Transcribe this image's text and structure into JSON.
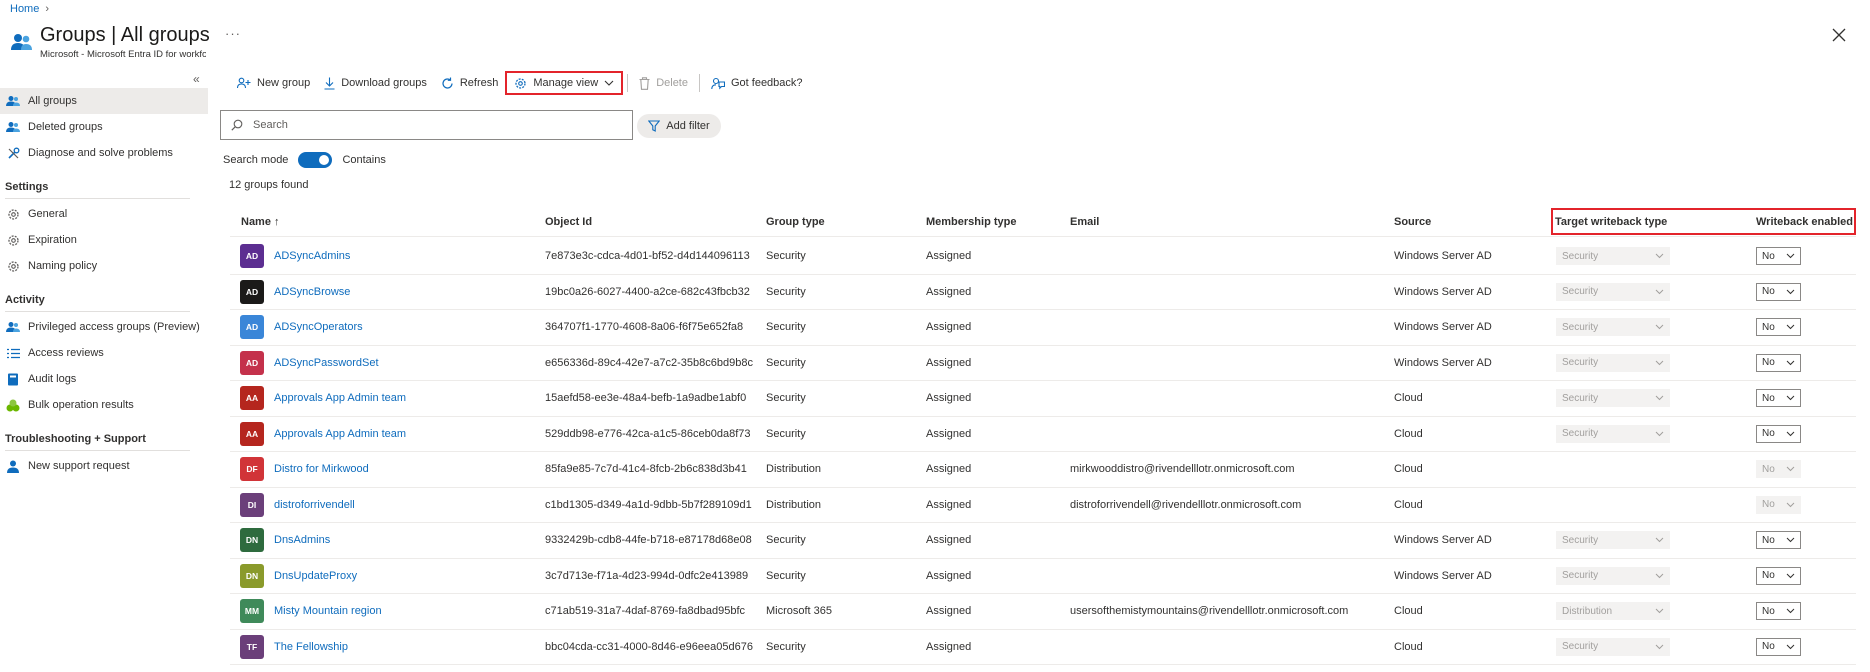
{
  "breadcrumb": {
    "home": "Home",
    "separator": "›"
  },
  "header": {
    "title": "Groups | All groups",
    "subtitle": "Microsoft - Microsoft Entra ID for workforce",
    "more": "···"
  },
  "sidebar": {
    "collapse": "«",
    "items": [
      {
        "label": "All groups",
        "icon": "groups-icon"
      },
      {
        "label": "Deleted groups",
        "icon": "groups-icon"
      },
      {
        "label": "Diagnose and solve problems",
        "icon": "wrench-icon"
      }
    ],
    "settings_title": "Settings",
    "settings": [
      {
        "label": "General",
        "icon": "gear-icon"
      },
      {
        "label": "Expiration",
        "icon": "gear-icon"
      },
      {
        "label": "Naming policy",
        "icon": "gear-icon"
      }
    ],
    "activity_title": "Activity",
    "activity": [
      {
        "label": "Privileged access groups (Preview)",
        "icon": "groups-icon"
      },
      {
        "label": "Access reviews",
        "icon": "list-icon"
      },
      {
        "label": "Audit logs",
        "icon": "book-icon"
      },
      {
        "label": "Bulk operation results",
        "icon": "bulk-icon"
      }
    ],
    "support_title": "Troubleshooting + Support",
    "support": [
      {
        "label": "New support request",
        "icon": "person-icon"
      }
    ]
  },
  "toolbar": {
    "new_group": "New group",
    "download": "Download groups",
    "refresh": "Refresh",
    "manage_view": "Manage view",
    "delete": "Delete",
    "feedback": "Got feedback?"
  },
  "search": {
    "placeholder": "Search",
    "add_filter": "Add filter",
    "mode_label": "Search mode",
    "mode_value": "Contains"
  },
  "found_text": "12 groups found",
  "columns": {
    "name": "Name ↑",
    "object_id": "Object Id",
    "group_type": "Group type",
    "membership_type": "Membership type",
    "email": "Email",
    "source": "Source",
    "target_writeback": "Target writeback type",
    "writeback_enabled": "Writeback enabled"
  },
  "colors": {
    "accent": "#0f6cbd",
    "highlight": "#e3242b"
  },
  "rows": [
    {
      "initials": "AD",
      "color": "#5c2e91",
      "name": "ADSyncAdmins",
      "object_id": "7e873e3c-cdca-4d01-bf52-d4d144096113",
      "group_type": "Security",
      "membership": "Assigned",
      "email": "",
      "source": "Windows Server AD",
      "target": "Security",
      "writeback": "No",
      "writeback_active": true
    },
    {
      "initials": "AD",
      "color": "#1b1a19",
      "name": "ADSyncBrowse",
      "object_id": "19bc0a26-6027-4400-a2ce-682c43fbcb32",
      "group_type": "Security",
      "membership": "Assigned",
      "email": "",
      "source": "Windows Server AD",
      "target": "Security",
      "writeback": "No",
      "writeback_active": true
    },
    {
      "initials": "AD",
      "color": "#3a86d8",
      "name": "ADSyncOperators",
      "object_id": "364707f1-1770-4608-8a06-f6f75e652fa8",
      "group_type": "Security",
      "membership": "Assigned",
      "email": "",
      "source": "Windows Server AD",
      "target": "Security",
      "writeback": "No",
      "writeback_active": true
    },
    {
      "initials": "AD",
      "color": "#c4314b",
      "name": "ADSyncPasswordSet",
      "object_id": "e656336d-89c4-42e7-a7c2-35b8c6bd9b8c",
      "group_type": "Security",
      "membership": "Assigned",
      "email": "",
      "source": "Windows Server AD",
      "target": "Security",
      "writeback": "No",
      "writeback_active": true
    },
    {
      "initials": "AA",
      "color": "#b5261e",
      "name": "Approvals App Admin team",
      "object_id": "15aefd58-ee3e-48a4-befb-1a9adbe1abf0",
      "group_type": "Security",
      "membership": "Assigned",
      "email": "",
      "source": "Cloud",
      "target": "Security",
      "writeback": "No",
      "writeback_active": true
    },
    {
      "initials": "AA",
      "color": "#b5261e",
      "name": "Approvals App Admin team",
      "object_id": "529ddb98-e776-42ca-a1c5-86ceb0da8f73",
      "group_type": "Security",
      "membership": "Assigned",
      "email": "",
      "source": "Cloud",
      "target": "Security",
      "writeback": "No",
      "writeback_active": true
    },
    {
      "initials": "DF",
      "color": "#d13438",
      "name": "Distro for Mirkwood",
      "object_id": "85fa9e85-7c7d-41c4-8fcb-2b6c838d3b41",
      "group_type": "Distribution",
      "membership": "Assigned",
      "email": "mirkwooddistro@rivendelllotr.onmicrosoft.com",
      "source": "Cloud",
      "target": "",
      "writeback": "No",
      "writeback_active": false
    },
    {
      "initials": "DI",
      "color": "#6b3f7a",
      "name": "distroforrivendell",
      "object_id": "c1bd1305-d349-4a1d-9dbb-5b7f289109d1",
      "group_type": "Distribution",
      "membership": "Assigned",
      "email": "distroforrivendell@rivendelllotr.onmicrosoft.com",
      "source": "Cloud",
      "target": "",
      "writeback": "No",
      "writeback_active": false
    },
    {
      "initials": "DN",
      "color": "#2e6b3e",
      "name": "DnsAdmins",
      "object_id": "9332429b-cdb8-44fe-b718-e87178d68e08",
      "group_type": "Security",
      "membership": "Assigned",
      "email": "",
      "source": "Windows Server AD",
      "target": "Security",
      "writeback": "No",
      "writeback_active": true
    },
    {
      "initials": "DN",
      "color": "#8a9a2b",
      "name": "DnsUpdateProxy",
      "object_id": "3c7d713e-f71a-4d23-994d-0dfc2e413989",
      "group_type": "Security",
      "membership": "Assigned",
      "email": "",
      "source": "Windows Server AD",
      "target": "Security",
      "writeback": "No",
      "writeback_active": true
    },
    {
      "initials": "MM",
      "color": "#3f8a5a",
      "name": "Misty Mountain region",
      "object_id": "c71ab519-31a7-4daf-8769-fa8dbad95bfc",
      "group_type": "Microsoft 365",
      "membership": "Assigned",
      "email": "usersofthemistymountains@rivendelllotr.onmicrosoft.com",
      "source": "Cloud",
      "target": "Distribution",
      "writeback": "No",
      "writeback_active": true
    },
    {
      "initials": "TF",
      "color": "#6b3f7a",
      "name": "The Fellowship",
      "object_id": "bbc04cda-cc31-4000-8d46-e96eea05d676",
      "group_type": "Security",
      "membership": "Assigned",
      "email": "",
      "source": "Cloud",
      "target": "Security",
      "writeback": "No",
      "writeback_active": true
    }
  ]
}
